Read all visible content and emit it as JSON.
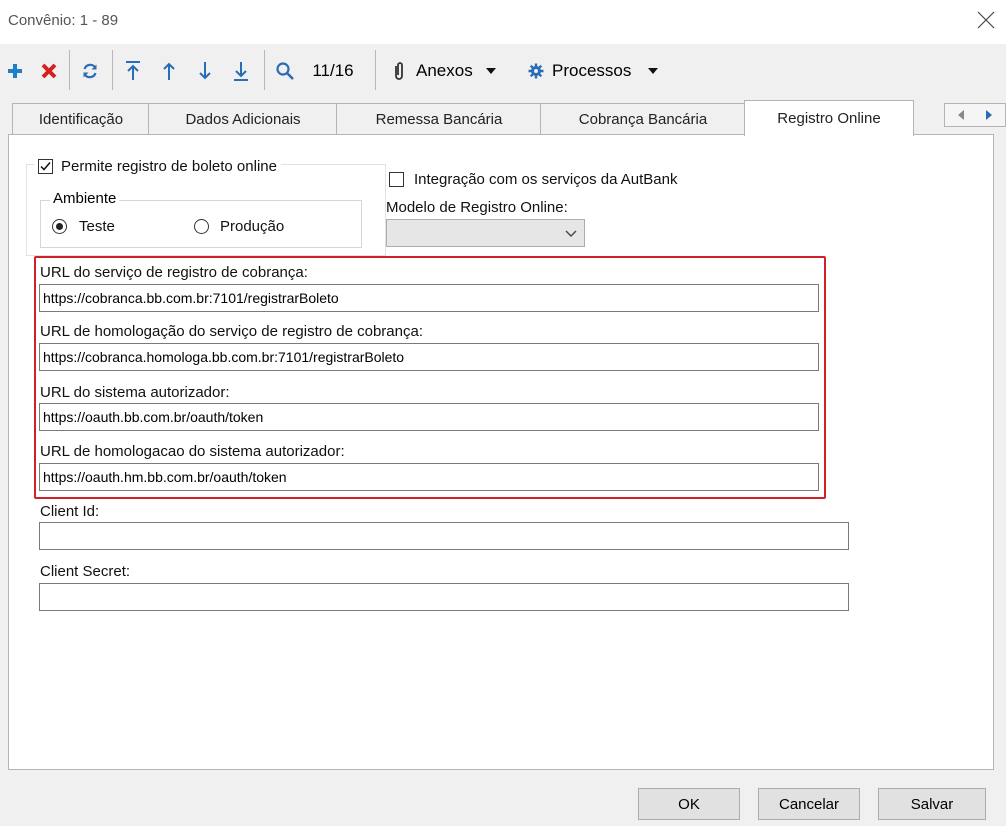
{
  "window": {
    "title": "Convênio: 1 - 89"
  },
  "toolbar": {
    "record_counter": "11/16",
    "anexos_label": "Anexos",
    "processos_label": "Processos"
  },
  "tabs": [
    {
      "label": "Identificação"
    },
    {
      "label": "Dados Adicionais"
    },
    {
      "label": "Remessa Bancária"
    },
    {
      "label": "Cobrança Bancária"
    },
    {
      "label": "Registro Online"
    }
  ],
  "form": {
    "permite_registro": {
      "label": "Permite registro de boleto online",
      "checked": true
    },
    "ambiente": {
      "legend": "Ambiente",
      "options": [
        {
          "label": "Teste",
          "selected": true
        },
        {
          "label": "Produção",
          "selected": false
        }
      ]
    },
    "integracao": {
      "label": "Integração com os serviços da AutBank",
      "checked": false
    },
    "modelo": {
      "label": "Modelo de Registro Online:",
      "value": ""
    },
    "fields": [
      {
        "label": "URL do serviço de registro de cobrança:",
        "value": "https://cobranca.bb.com.br:7101/registrarBoleto"
      },
      {
        "label": "URL de homologação do serviço de registro de cobrança:",
        "value": "https://cobranca.homologa.bb.com.br:7101/registrarBoleto"
      },
      {
        "label": "URL do sistema autorizador:",
        "value": "https://oauth.bb.com.br/oauth/token"
      },
      {
        "label": "URL de homologacao do sistema autorizador:",
        "value": "https://oauth.hm.bb.com.br/oauth/token"
      },
      {
        "label": "Client Id:",
        "value": ""
      },
      {
        "label": "Client Secret:",
        "value": ""
      }
    ]
  },
  "buttons": {
    "ok": "OK",
    "cancelar": "Cancelar",
    "salvar": "Salvar"
  },
  "colors": {
    "add": "#1e7fc8",
    "delete": "#d42020",
    "toolbar_icon": "#2a6db5",
    "highlight": "#d0202a"
  }
}
